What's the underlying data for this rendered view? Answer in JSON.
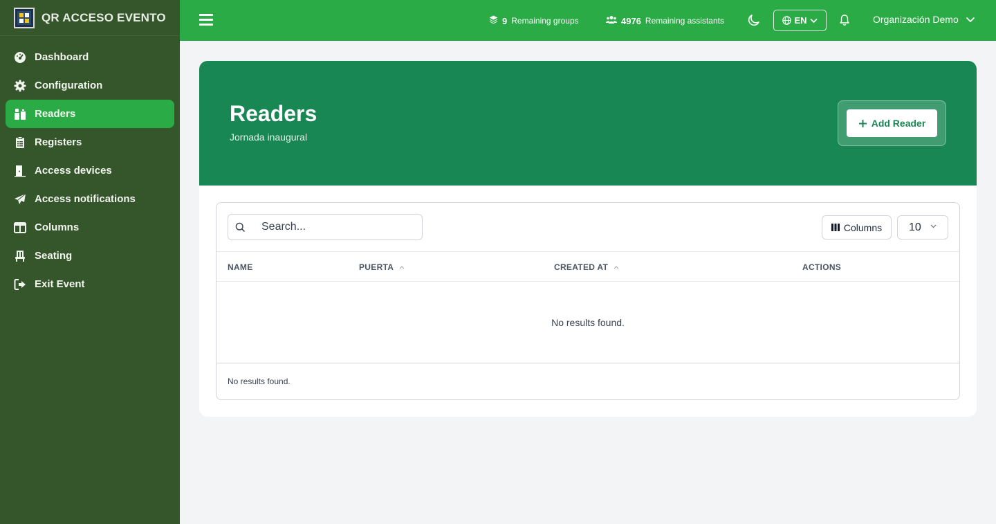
{
  "app": {
    "title": "QR ACCESO EVENTO"
  },
  "sidebar": {
    "items": [
      {
        "label": "Dashboard",
        "icon": "dashboard-icon"
      },
      {
        "label": "Configuration",
        "icon": "gear-icon"
      },
      {
        "label": "Readers",
        "icon": "readers-icon",
        "active": true
      },
      {
        "label": "Registers",
        "icon": "clipboard-icon"
      },
      {
        "label": "Access devices",
        "icon": "door-icon"
      },
      {
        "label": "Access notifications",
        "icon": "paper-plane-icon"
      },
      {
        "label": "Columns",
        "icon": "columns-icon"
      },
      {
        "label": "Seating",
        "icon": "chair-icon"
      },
      {
        "label": "Exit Event",
        "icon": "exit-icon"
      }
    ]
  },
  "topbar": {
    "groups_count": "9",
    "groups_label": "Remaining groups",
    "assistants_count": "4976",
    "assistants_label": "Remaining assistants",
    "language": "EN",
    "organization": "Organización Demo"
  },
  "page": {
    "title": "Readers",
    "subtitle": "Jornada inaugural",
    "add_button": "Add Reader"
  },
  "table": {
    "search_placeholder": "Search...",
    "columns_button": "Columns",
    "per_page": "10",
    "headers": [
      "NAME",
      "PUERTA",
      "CREATED AT",
      "ACTIONS"
    ],
    "empty_message": "No results found.",
    "footer_message": "No results found."
  },
  "colors": {
    "sidebar_bg": "#35552a",
    "topbar_bg": "#2aab45",
    "hero_bg": "#198754",
    "active_item": "#2aab45"
  }
}
